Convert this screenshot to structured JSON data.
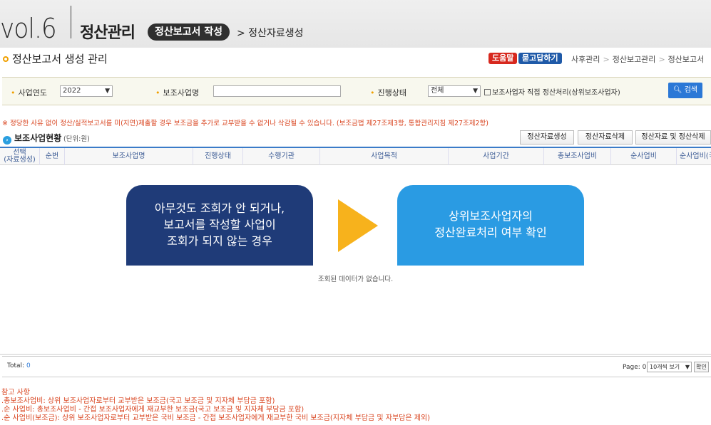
{
  "header": {
    "vol": "vol.6",
    "category": "정산관리",
    "pill": "정산보고서 작성",
    "crumb": "> 정산자료생성"
  },
  "panel": {
    "title": "정산보고서 생성 관리",
    "help_label": "도움말",
    "qa_label": "묻고답하기",
    "path": [
      "사후관리",
      "정산보고관리",
      "정산보고서"
    ]
  },
  "search": {
    "year_label": "사업연도",
    "year_value": "2022",
    "name_label": "보조사업명",
    "name_value": "",
    "status_label": "진행상태",
    "status_value": "전체",
    "check_label": "보조사업자 직접 정산처리(상위보조사업자)",
    "search_label": "검색"
  },
  "warning": "※ 정당한 사유 없이 정산/실적보고서를 미(지연)제출할 경우 보조금을 추가로 교부받을 수 없거나 삭감될 수 있습니다. (보조금법 제27조제3항, 통합관리지침 제27조제2항)",
  "section": {
    "title": "보조사업현황",
    "unit": "(단위:원)",
    "buttons": [
      "정산자료생성",
      "정산자료삭제",
      "정산자료 및 정산삭제"
    ]
  },
  "table": {
    "headers": [
      "선택\n(자료생성)",
      "순번",
      "보조사업명",
      "진행상태",
      "수행기관",
      "사업목적",
      "사업기간",
      "총보조사업비",
      "순사업비",
      "순사업비(국"
    ],
    "empty_text": "조회된 데이터가 없습니다."
  },
  "overlay": {
    "left_line1": "아무것도 조회가 안 되거나,",
    "left_line2": "보고서를 작성할 사업이",
    "left_line3": "조회가 되지 않는 경우",
    "right_line1": "상위보조사업자의",
    "right_line2": "정산완료처리 여부 확인"
  },
  "pager": {
    "total_label": "Total:",
    "total_value": "0",
    "page_label": "Page: 0",
    "per_page": "10개씩 보기",
    "ok_label": "확인"
  },
  "notes": {
    "title": "참고 사항",
    "line1": ".총보조사업비: 상위 보조사업자로부터 교부받은 보조금(국고 보조금 및 지자체 부담금 포함)",
    "line2": ".순 사업비: 총보조사업비 - 간접 보조사업자에게 재교부한 보조금(국고 보조금 및 지자체 부담금 포함)",
    "line3": ".순 사업비(보조금): 상위 보조사업자로부터 교부받은 국비 보조금 - 간접 보조사업자에게 재교부한 국비 보조금(지자체 부담금 및 자부담은 제외)"
  },
  "colors": {
    "accent_blue": "#2b78d6",
    "dark_navy": "#1f3b78",
    "light_blue": "#2a9be3",
    "arrow_yellow": "#f7b21c",
    "warning_red": "#d9431e"
  }
}
